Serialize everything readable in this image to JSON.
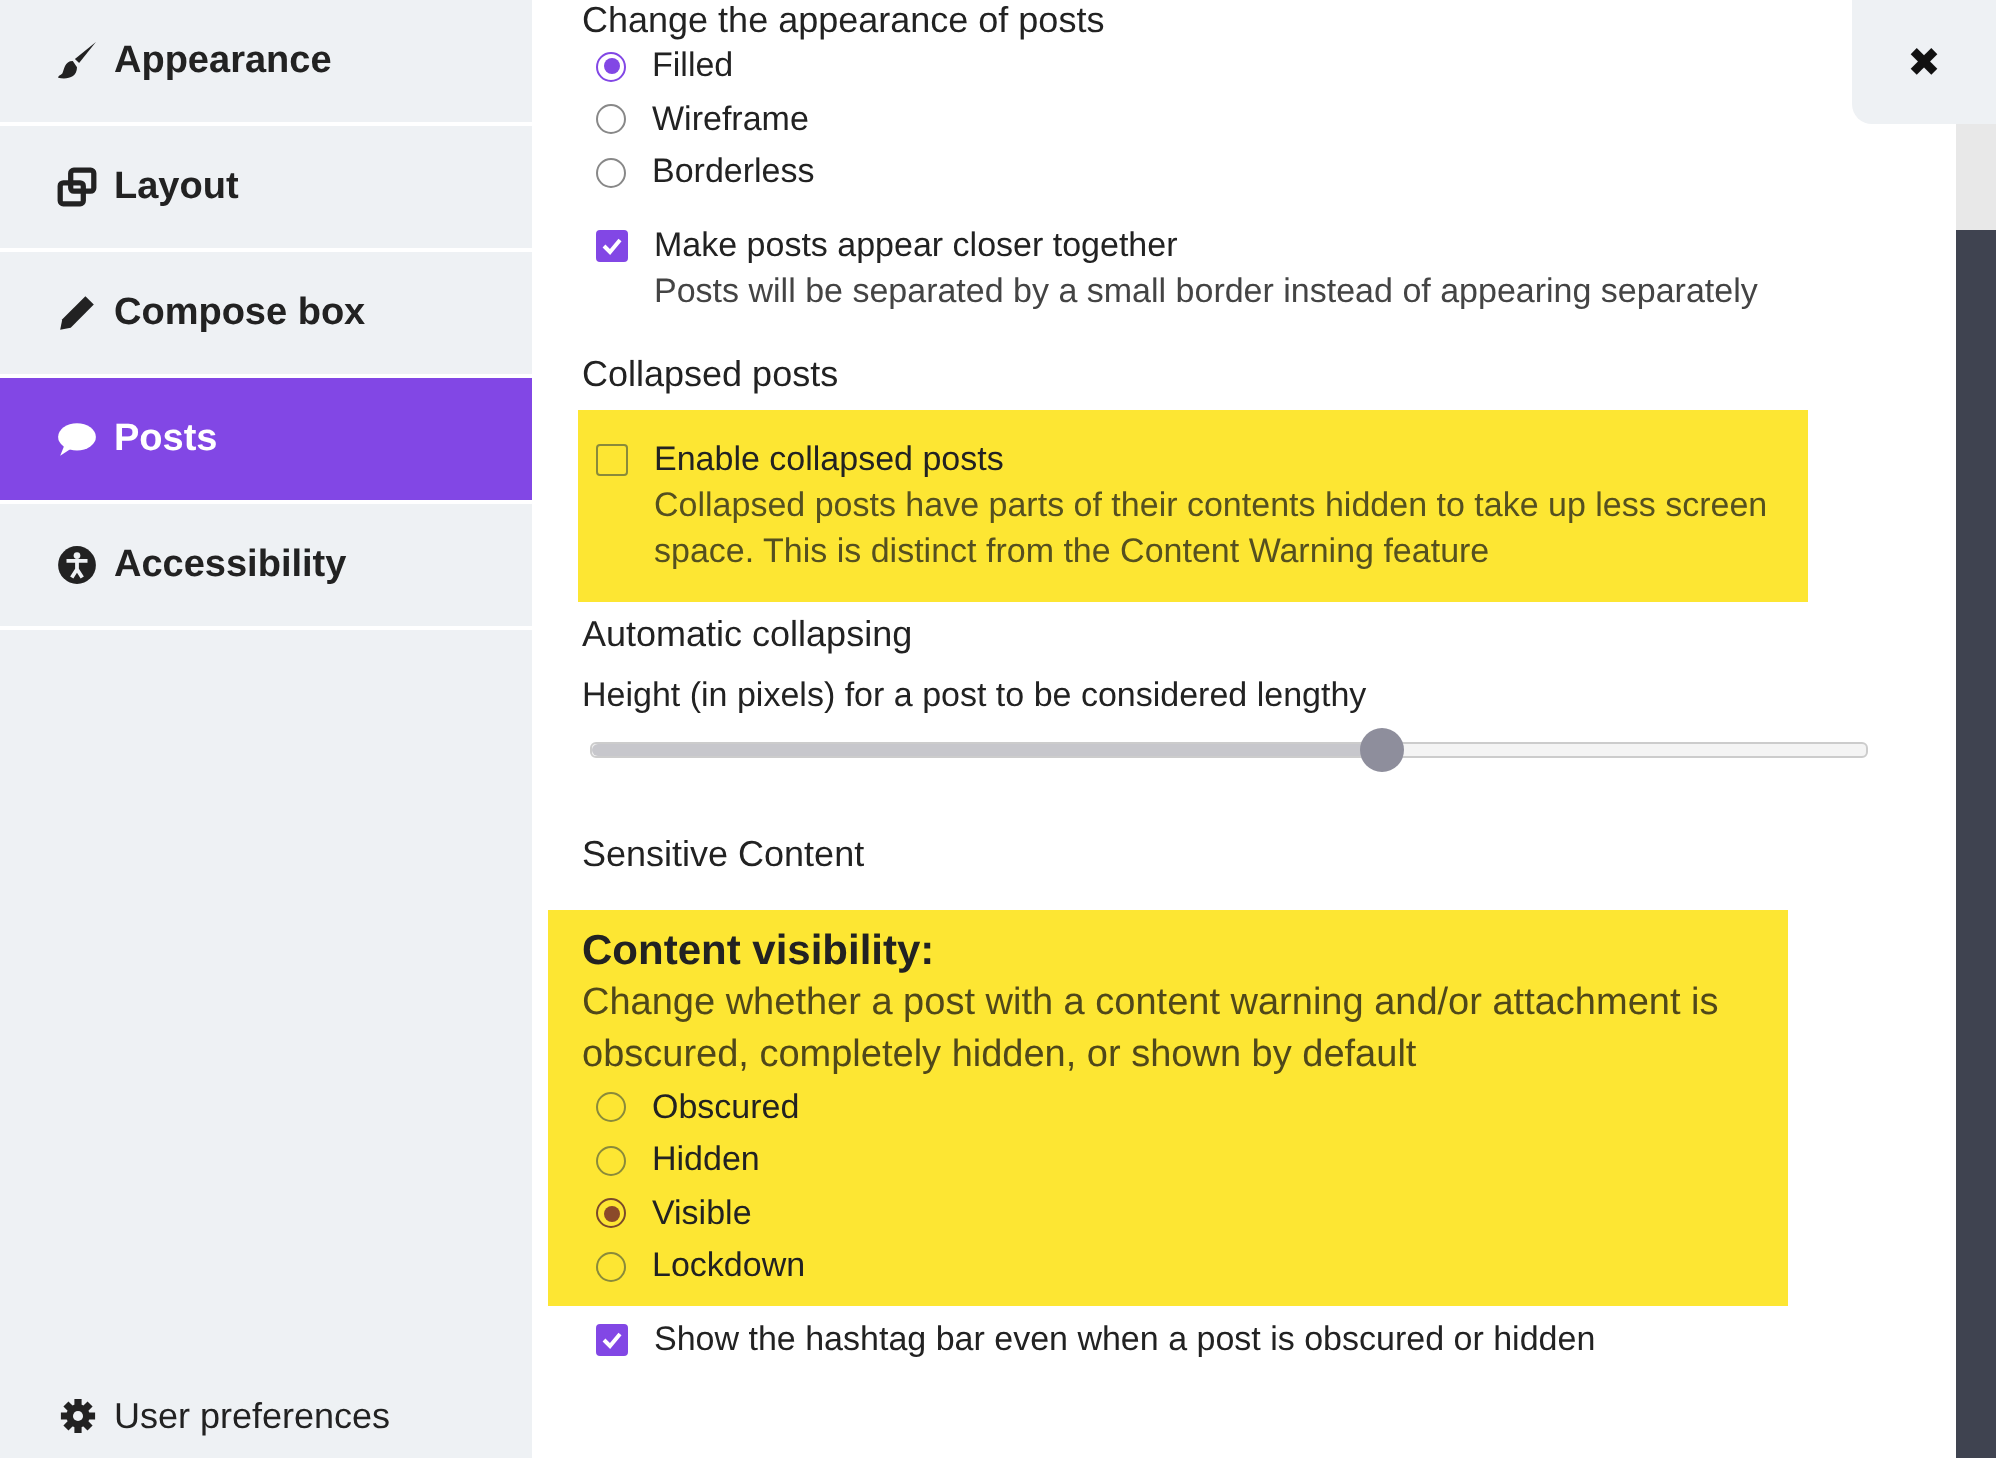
{
  "sidebar": {
    "items": [
      {
        "label": "Appearance",
        "selected": false
      },
      {
        "label": "Layout",
        "selected": false
      },
      {
        "label": "Compose box",
        "selected": false
      },
      {
        "label": "Posts",
        "selected": true
      },
      {
        "label": "Accessibility",
        "selected": false
      }
    ],
    "footer": {
      "label": "User preferences"
    }
  },
  "close_button": {
    "label": "✖"
  },
  "appearance": {
    "heading": "Change the appearance of posts",
    "options": [
      {
        "label": "Filled",
        "selected": true
      },
      {
        "label": "Wireframe",
        "selected": false
      },
      {
        "label": "Borderless",
        "selected": false
      }
    ],
    "compact": {
      "label": "Make posts appear closer together",
      "description": "Posts will be separated by a small border instead of appearing separately",
      "checked": true,
      "highlighted": false
    }
  },
  "collapsed": {
    "heading": "Collapsed posts",
    "enable": {
      "label": "Enable collapsed posts",
      "description": "Collapsed posts have parts of their contents hidden to take up less screen space. This is distinct from the Content Warning feature",
      "checked": false,
      "highlighted": true
    }
  },
  "auto_collapse": {
    "heading": "Automatic collapsing",
    "label": "Height (in pixels) for a post to be considered lengthy",
    "level": 0.62
  },
  "sensitive": {
    "heading": "Sensitive Content",
    "visibility": {
      "title": "Content visibility:",
      "description": "Change whether a post with a content warning and/or attachment is obscured, completely hidden, or shown by default",
      "highlighted": true,
      "options": [
        {
          "label": "Obscured",
          "selected": false
        },
        {
          "label": "Hidden",
          "selected": false
        },
        {
          "label": "Visible",
          "selected": true
        },
        {
          "label": "Lockdown",
          "selected": false
        }
      ]
    },
    "hashtag": {
      "label": "Show the hashtag bar even when a post is obscured or hidden",
      "checked": true,
      "highlighted": false
    }
  }
}
